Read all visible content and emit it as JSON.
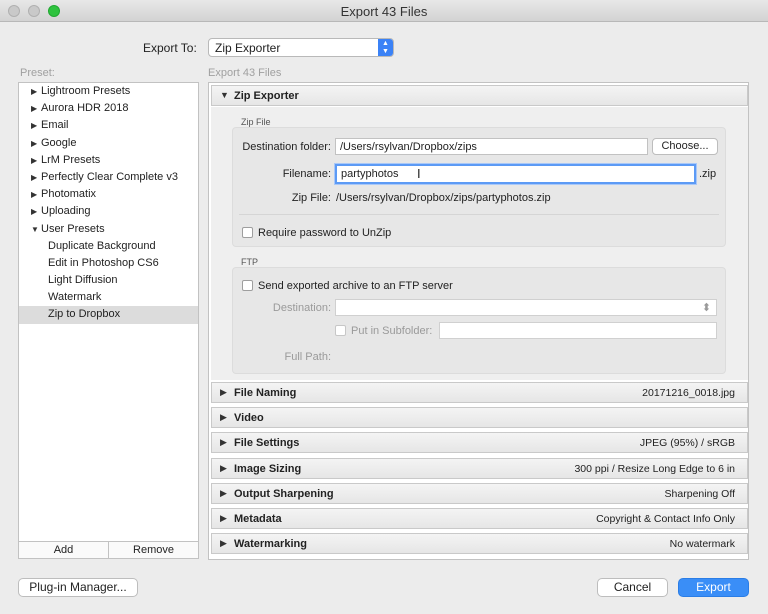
{
  "window": {
    "title": "Export 43 Files"
  },
  "export_to": {
    "label": "Export To:",
    "value": "Zip Exporter"
  },
  "preset_label": "Preset:",
  "export_count": "Export 43 Files",
  "presets": [
    {
      "label": "Lightroom Presets",
      "kind": "folder",
      "expanded": false
    },
    {
      "label": "Aurora HDR 2018",
      "kind": "folder",
      "expanded": false
    },
    {
      "label": "Email",
      "kind": "folder",
      "expanded": false
    },
    {
      "label": "Google",
      "kind": "folder",
      "expanded": false
    },
    {
      "label": "LrM Presets",
      "kind": "folder",
      "expanded": false
    },
    {
      "label": "Perfectly Clear Complete v3",
      "kind": "folder",
      "expanded": false
    },
    {
      "label": "Photomatix",
      "kind": "folder",
      "expanded": false
    },
    {
      "label": "Uploading",
      "kind": "folder",
      "expanded": false
    },
    {
      "label": "User Presets",
      "kind": "folder",
      "expanded": true
    },
    {
      "label": "Duplicate Background",
      "kind": "child"
    },
    {
      "label": "Edit in Photoshop CS6",
      "kind": "child"
    },
    {
      "label": "Light Diffusion",
      "kind": "child"
    },
    {
      "label": "Watermark",
      "kind": "child"
    },
    {
      "label": "Zip to Dropbox",
      "kind": "child",
      "selected": true
    }
  ],
  "preset_buttons": {
    "add": "Add",
    "remove": "Remove"
  },
  "zip_exporter": {
    "title": "Zip Exporter",
    "zip_file_group": "Zip File",
    "destination_label": "Destination folder:",
    "destination_value": "/Users/rsylvan/Dropbox/zips",
    "choose_button": "Choose...",
    "filename_label": "Filename:",
    "filename_value": "partyphotos",
    "filename_ext": ".zip",
    "zipfile_label": "Zip File:",
    "zipfile_value": "/Users/rsylvan/Dropbox/zips/partyphotos.zip",
    "require_password": "Require password to UnZip",
    "ftp_group": "FTP",
    "send_ftp": "Send exported archive to an FTP server",
    "ftp_destination_label": "Destination:",
    "put_in_subfolder": "Put in Subfolder:",
    "full_path_label": "Full Path:"
  },
  "sections": [
    {
      "name": "File Naming",
      "summary": "20171216_0018.jpg"
    },
    {
      "name": "Video",
      "summary": ""
    },
    {
      "name": "File Settings",
      "summary": "JPEG (95%) / sRGB"
    },
    {
      "name": "Image Sizing",
      "summary": "300 ppi / Resize Long Edge to 6 in"
    },
    {
      "name": "Output Sharpening",
      "summary": "Sharpening Off"
    },
    {
      "name": "Metadata",
      "summary": "Copyright & Contact Info Only"
    },
    {
      "name": "Watermarking",
      "summary": "No watermark"
    }
  ],
  "footer": {
    "plugin_manager": "Plug-in Manager...",
    "cancel": "Cancel",
    "export": "Export"
  },
  "icons": {
    "collapsed": "▶",
    "expanded": "▼",
    "select_up": "▲",
    "select_down": "▼",
    "updown": "⬍",
    "ibeam": "I"
  },
  "colors": {
    "accent": "#3a8ef7",
    "focus_ring": "#5c9af5",
    "selected_row": "#dcdcdc"
  }
}
